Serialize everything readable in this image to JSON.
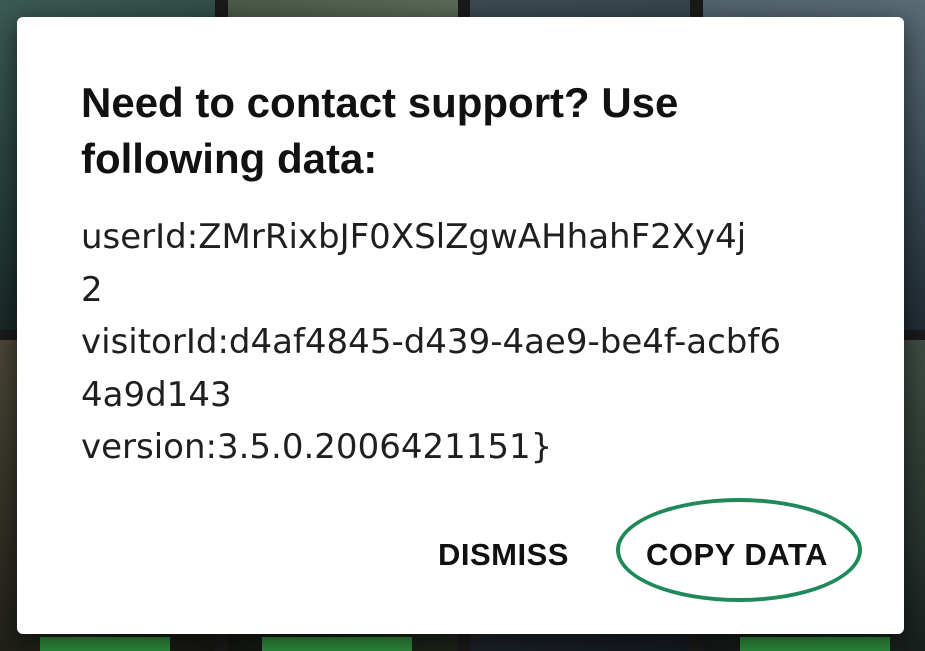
{
  "dialog": {
    "title": "Need to contact support? Use following data:",
    "body_lines": [
      "userId:ZMrRixbJF0XSlZgwAHhahF2Xy4j",
      "2",
      "visitorId:d4af4845-d439-4ae9-be4f-acbf6",
      "4a9d143",
      "version:3.5.0.2006421151}"
    ],
    "buttons": {
      "dismiss": "DISMISS",
      "copy": "COPY DATA"
    }
  },
  "colors": {
    "highlight": "#1e8a5a",
    "dialog_background": "#ffffff",
    "text": "#111111"
  }
}
